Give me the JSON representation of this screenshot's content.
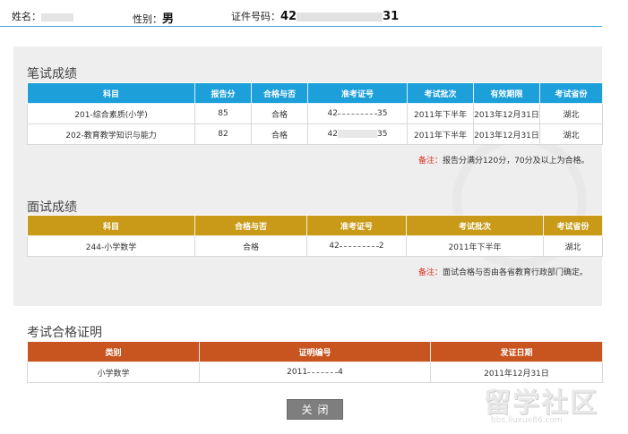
{
  "header": {
    "name_label": "姓名：",
    "name_value": "",
    "gender_label": "性别：",
    "gender_value": "男",
    "id_label": "证件号码：",
    "id_value": "42",
    "id_suffix": "31"
  },
  "written": {
    "title": "笔试成绩",
    "columns": [
      "科目",
      "报告分",
      "合格与否",
      "准考证号",
      "考试批次",
      "有效期限",
      "考试省份"
    ],
    "rows": [
      [
        "201-综合素质(小学)",
        "85",
        "合格",
        "42",
        "35",
        "2011年下半年",
        "2013年12月31日",
        "湖北"
      ],
      [
        "202-教育教学知识与能力",
        "82",
        "合格",
        "42",
        "35",
        "2011年下半年",
        "2013年12月31日",
        "湖北"
      ]
    ],
    "note_label": "备注：",
    "note_text": "报告分满分120分，70分及以上为合格。"
  },
  "interview": {
    "title": "面试成绩",
    "columns": [
      "科目",
      "合格与否",
      "准考证号",
      "考试批次",
      "考试省份"
    ],
    "rows": [
      [
        "244-小学数学",
        "合格",
        "42",
        "2",
        "2011年下半年",
        "湖北"
      ]
    ],
    "note_label": "备注：",
    "note_text": "面试合格与否由各省教育行政部门确定。"
  },
  "certificate": {
    "title": "考试合格证明",
    "columns": [
      "类别",
      "证明编号",
      "发证日期"
    ],
    "rows": [
      [
        "小学数学",
        "2011",
        "4",
        "2011年12月31日"
      ]
    ]
  },
  "buttons": {
    "close": "关闭"
  },
  "watermark": {
    "text": "留学社区",
    "url": "bbs.liuxue86.com"
  },
  "colors": {
    "written_header": "#1d9fd9",
    "interview_header": "#c89a18",
    "cert_header": "#c8541f",
    "note_label": "#d9321f"
  }
}
